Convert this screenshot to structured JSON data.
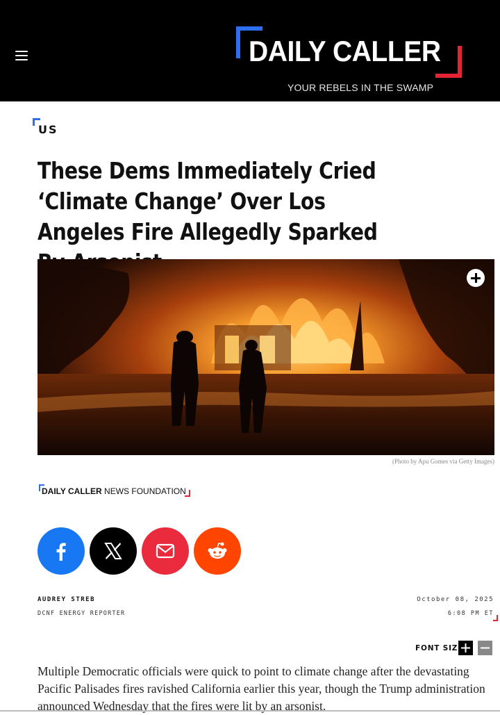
{
  "header": {
    "logo_text": "DAILY CALLER",
    "tagline": "YOUR REBELS IN THE SWAMP"
  },
  "article": {
    "category": "US",
    "headline": "These Dems Immediately Cried ‘Climate Change’ Over Los Angeles Fire Allegedly Sparked By Arsonist",
    "photo_credit": "(Photo by Apu Gomes via Getty Images)",
    "source": {
      "brand": "DAILY CALLER",
      "suffix": "NEWS FOUNDATION"
    },
    "author": "AUDREY STREB",
    "author_role": "DCNF ENERGY REPORTER",
    "date": "October 08, 2025",
    "time": "6:08 PM ET",
    "font_size_label": "FONT SIZE:",
    "body": "Multiple Democratic officials were quick to point to climate change after the devastating Pacific Palisades fires ravished California earlier this year, though the Trump administration announced Wednesday that the fires were lit by an arsonist."
  },
  "share": {
    "facebook_icon": "facebook-icon",
    "x_icon": "x-icon",
    "email_icon": "email-icon",
    "reddit_icon": "reddit-icon"
  },
  "colors": {
    "header_bg": "#000000",
    "accent_blue": "#2d6ff0",
    "accent_red": "#e52433",
    "facebook": "#1877f2",
    "email": "#ea2a3d",
    "reddit": "#ff4500"
  }
}
